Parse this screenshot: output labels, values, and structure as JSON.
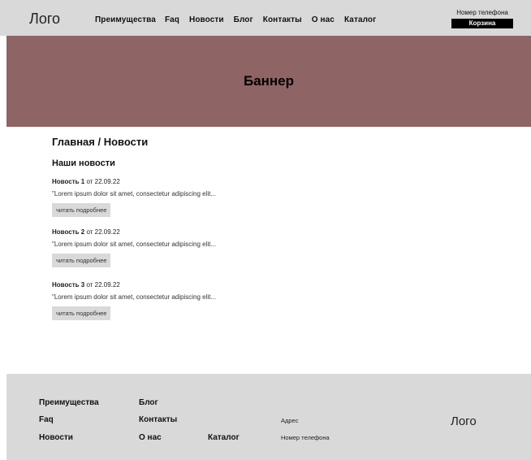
{
  "header": {
    "logo": "Лого",
    "nav": [
      "Преимущества",
      "Faq",
      "Новости",
      "Блог",
      "Контакты",
      "О нас",
      "Каталог"
    ],
    "phone": "Номер телефона",
    "cart": "Корзина"
  },
  "banner": {
    "text": "Баннер"
  },
  "breadcrumb": "Главная / Новости",
  "section_title": "Наши новости",
  "news": [
    {
      "title": "Новость 1",
      "date_prefix": "от",
      "date": "22.09.22",
      "excerpt": "\"Lorem ipsum dolor sit amet, consectetur adipiscing elit...",
      "more": "читать подробнее"
    },
    {
      "title": "Новость 2",
      "date_prefix": "от",
      "date": "22.09.22",
      "excerpt": "\"Lorem ipsum dolor sit amet, consectetur adipiscing elit...",
      "more": "читать подробнее"
    },
    {
      "title": "Новость 3",
      "date_prefix": "от",
      "date": "22.09.22",
      "excerpt": "\"Lorem ipsum dolor sit amet, consectetur adipiscing elit...",
      "more": "читать подробнее"
    }
  ],
  "footer": {
    "links": [
      "Преимущества",
      "Блог",
      "Faq",
      "Контакты",
      "Новости",
      "О нас",
      "Каталог"
    ],
    "address": "Адрес",
    "phone": "Номер телефона",
    "logo": "Лого"
  },
  "colors": {
    "header_bg": "#d9d9d9",
    "banner_bg": "#8e6464",
    "footer_bg": "#d9d9d9",
    "cart_bg": "#000000"
  }
}
